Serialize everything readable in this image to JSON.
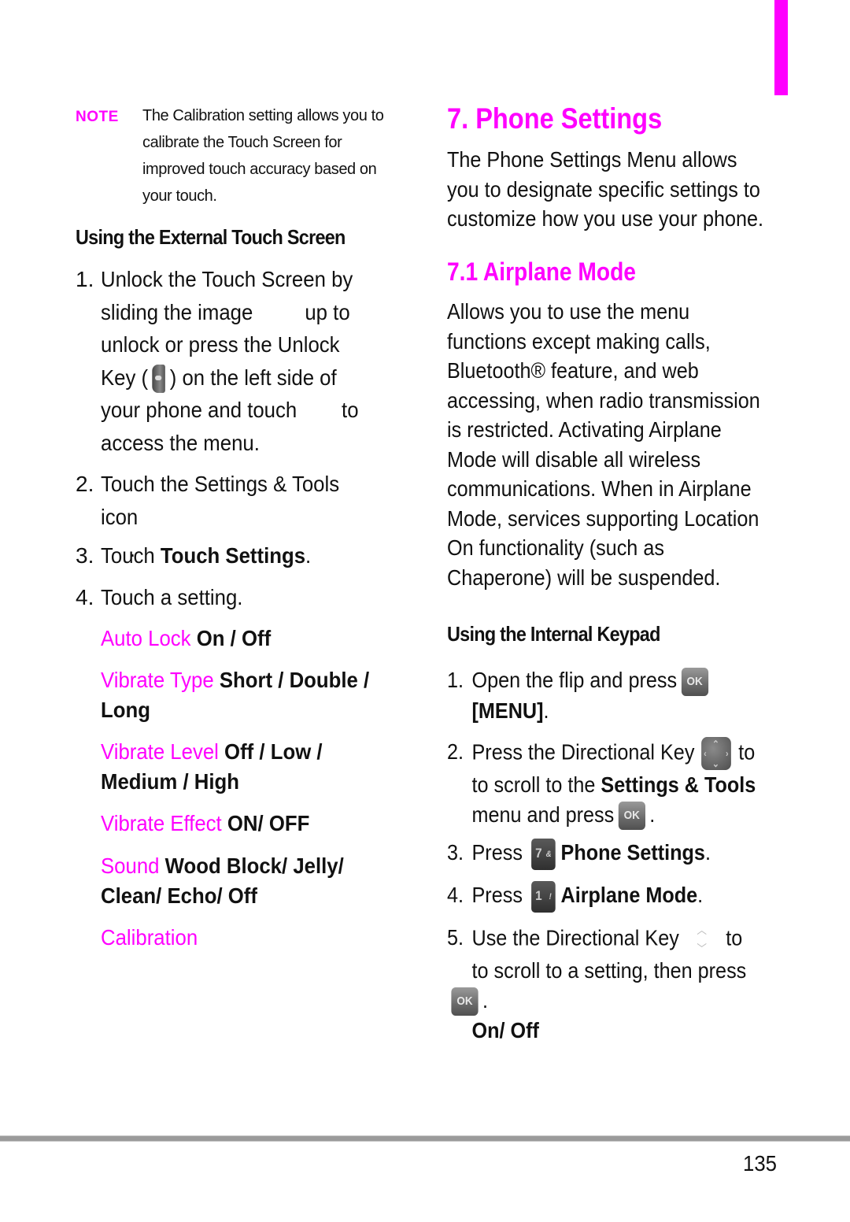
{
  "colors": {
    "accent": "#ff00ff",
    "text": "#111111",
    "rule": "#9b9b9b"
  },
  "left": {
    "note": {
      "label": "NOTE",
      "text": "The Calibration setting allows you to calibrate the Touch Screen for improved touch accuracy based on your touch."
    },
    "heading": "Using the External Touch Screen",
    "steps": [
      {
        "num": "1.",
        "parts": {
          "a": "Unlock the Touch Screen by sliding the image",
          "b": "up to unlock or press the Unlock Key (",
          "c": ") on the left side of your phone and touch",
          "d": "to access the menu."
        },
        "icon": "unlock-key-icon"
      },
      {
        "num": "2.",
        "text": "Touch the Settings & Tools icon",
        "trail": "."
      },
      {
        "num": "3.",
        "prefix": "Touch ",
        "bold": "Touch Settings",
        "suffix": "."
      },
      {
        "num": "4.",
        "text": "Touch a setting."
      }
    ],
    "settings": [
      {
        "name": "Auto Lock",
        "options": "On / Off"
      },
      {
        "name": "Vibrate Type",
        "options": "Short / Double / Long"
      },
      {
        "name": "Vibrate Level",
        "options": "Off / Low / Medium / High"
      },
      {
        "name": "Vibrate Effect",
        "options": "ON/ OFF"
      },
      {
        "name": "Sound",
        "options": "Wood Block/ Jelly/ Clean/ Echo/ Off"
      },
      {
        "name": "Calibration",
        "options": ""
      }
    ]
  },
  "right": {
    "title": "7. Phone Settings",
    "intro": "The Phone Settings Menu allows you to designate specific settings to customize how you use your phone.",
    "section_title": "7.1 Airplane Mode",
    "section_body": "Allows you to use the menu functions except making calls, Bluetooth® feature, and web accessing, when radio transmission is restricted. Activating Airplane Mode will disable all wireless communications. When in Airplane Mode, services supporting Location On functionality (such as Chaperone) will be suspended.",
    "keypad_heading": "Using the Internal Keypad",
    "steps": [
      {
        "num": "1.",
        "text": "Open the flip and press",
        "bold": "[MENU]",
        "suffix": "."
      },
      {
        "num": "2.",
        "text_a": "Press the Directional Key",
        "text_b": "to scroll to the",
        "bold": "Settings & Tools",
        "text_c": "menu and press",
        "suffix": "."
      },
      {
        "num": "3.",
        "text": "Press",
        "key_digit": "7",
        "key_sym": "&",
        "bold": "Phone Settings",
        "suffix": "."
      },
      {
        "num": "4.",
        "text": "Press",
        "key_digit": "1",
        "key_sym": "!",
        "bold": "Airplane Mode",
        "suffix": "."
      },
      {
        "num": "5.",
        "text_a": "Use the Directional Key",
        "text_b": "to scroll to a setting, then press",
        "suffix": ".",
        "bold": "On/ Off"
      }
    ],
    "ok_key_label": "OK"
  },
  "footer": {
    "page_number": "135"
  }
}
